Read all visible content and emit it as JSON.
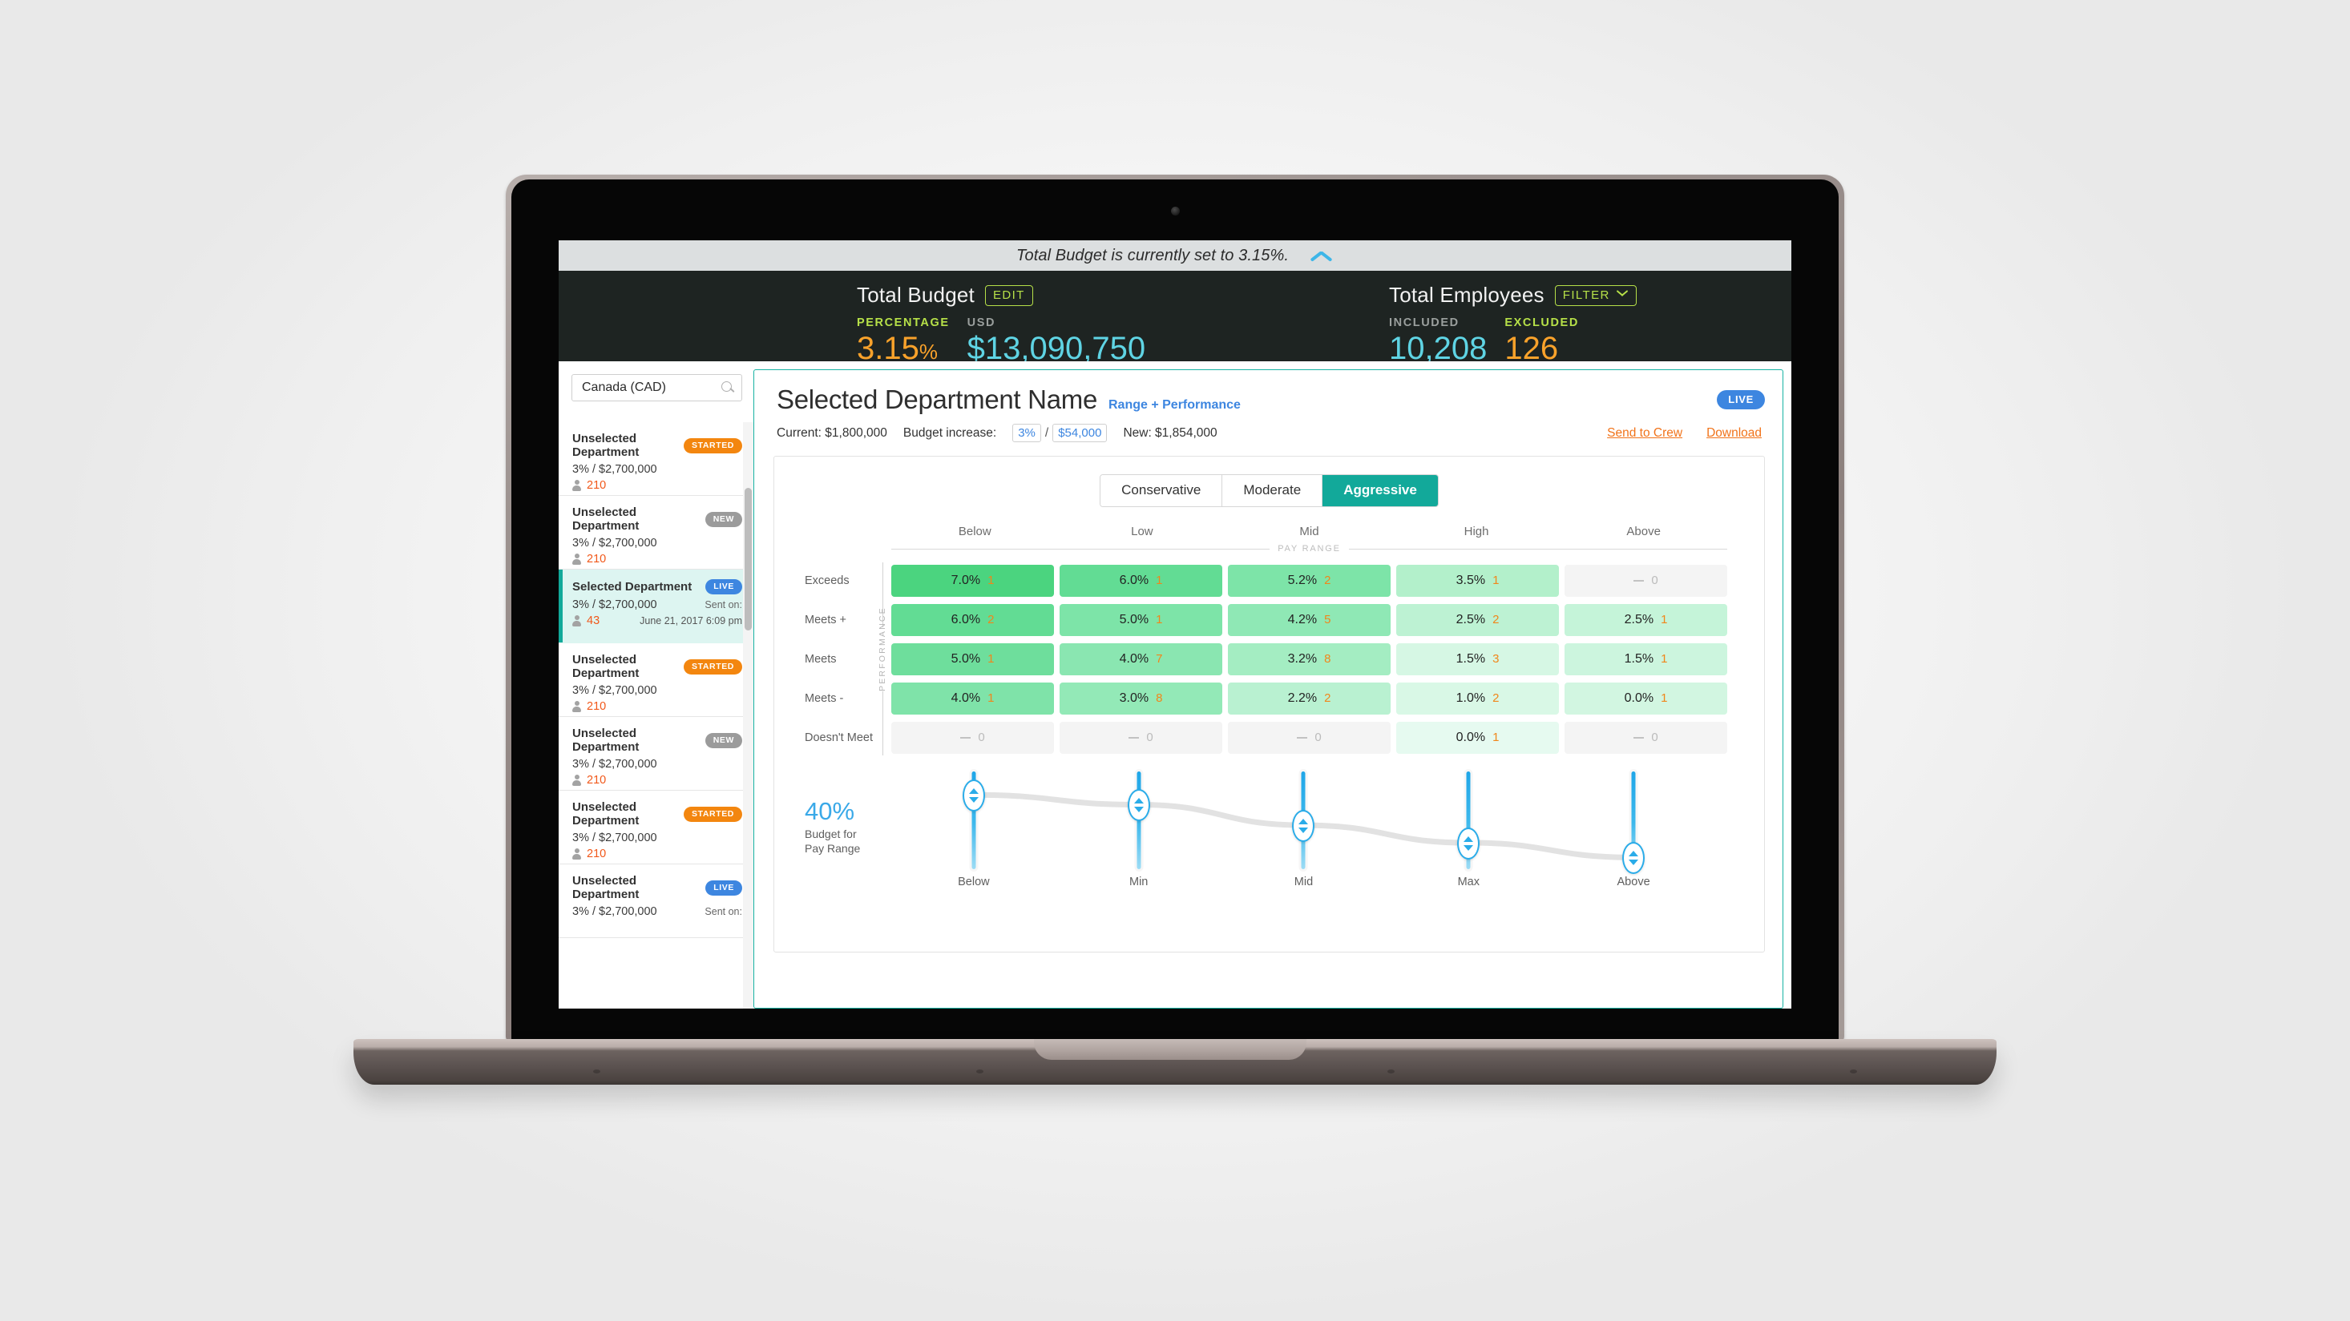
{
  "notice": {
    "text": "Total Budget is currently set to 3.15%.",
    "collapse_icon": "chevron-up-icon"
  },
  "header": {
    "budget": {
      "title": "Total Budget",
      "edit_label": "EDIT",
      "metrics": [
        {
          "label": "PERCENTAGE",
          "value": "3.15",
          "unit": "%"
        },
        {
          "label": "USD",
          "value": "$13,090,750",
          "unit": ""
        }
      ]
    },
    "employees": {
      "title": "Total Employees",
      "filter_label": "FILTER",
      "metrics": [
        {
          "label": "INCLUDED",
          "value": "10,208"
        },
        {
          "label": "EXCLUDED",
          "value": "126"
        }
      ]
    }
  },
  "sidebar": {
    "search": {
      "value": "Canada (CAD)",
      "placeholder": "Search",
      "icon": "search-icon"
    },
    "departments": [
      {
        "name": "Unselected Department",
        "badge": "STARTED",
        "badge_type": "started",
        "money": "3%  /  $2,700,000",
        "count": "210",
        "sent_label": "",
        "sent_date": "",
        "selected": false
      },
      {
        "name": "Unselected Department",
        "badge": "NEW",
        "badge_type": "new",
        "money": "3%  /  $2,700,000",
        "count": "210",
        "sent_label": "",
        "sent_date": "",
        "selected": false
      },
      {
        "name": "Selected Department",
        "badge": "LIVE",
        "badge_type": "live",
        "money": "3%  /  $2,700,000",
        "count": "43",
        "sent_label": "Sent on:",
        "sent_date": "June 21, 2017 6:09 pm",
        "selected": true
      },
      {
        "name": "Unselected Department",
        "badge": "STARTED",
        "badge_type": "started",
        "money": "3%  /  $2,700,000",
        "count": "210",
        "sent_label": "",
        "sent_date": "",
        "selected": false
      },
      {
        "name": "Unselected Department",
        "badge": "NEW",
        "badge_type": "new",
        "money": "3%  /  $2,700,000",
        "count": "210",
        "sent_label": "",
        "sent_date": "",
        "selected": false
      },
      {
        "name": "Unselected Department",
        "badge": "STARTED",
        "badge_type": "started",
        "money": "3%  /  $2,700,000",
        "count": "210",
        "sent_label": "",
        "sent_date": "",
        "selected": false
      },
      {
        "name": "Unselected Department",
        "badge": "LIVE",
        "badge_type": "live",
        "money": "3%  /  $2,700,000",
        "count": "",
        "sent_label": "Sent on:",
        "sent_date": "",
        "selected": false
      }
    ]
  },
  "main": {
    "title": "Selected Department Name",
    "subtitle": "Range + Performance",
    "live_badge": "LIVE",
    "current_label": "Current: $1,800,000",
    "increase_label": "Budget increase:",
    "increase_pct": "3%",
    "increase_amount": "$54,000",
    "new_label": "New: $1,854,000",
    "send_link": "Send to Crew",
    "download_link": "Download",
    "tabs": [
      {
        "label": "Conservative",
        "active": false
      },
      {
        "label": "Moderate",
        "active": false
      },
      {
        "label": "Aggressive",
        "active": true
      }
    ],
    "pay_range_axis": "PAY RANGE",
    "performance_axis": "PERFORMANCE",
    "budget_for_pay_range": {
      "percent": "40%",
      "line1": "Budget for",
      "line2": "Pay Range"
    }
  },
  "chart_data": {
    "type": "heatmap",
    "title": "Range + Performance matrix",
    "xlabel": "PAY RANGE",
    "ylabel": "PERFORMANCE",
    "categories": [
      "Below",
      "Low",
      "Mid",
      "High",
      "Above"
    ],
    "rows": [
      "Exceeds",
      "Meets +",
      "Meets",
      "Meets -",
      "Doesn't Meet"
    ],
    "cells": [
      [
        {
          "pct": "7.0%",
          "count": "1",
          "shade": "#4bd47f"
        },
        {
          "pct": "6.0%",
          "count": "1",
          "shade": "#62dc94"
        },
        {
          "pct": "5.2%",
          "count": "2",
          "shade": "#7de4a8"
        },
        {
          "pct": "3.5%",
          "count": "1",
          "shade": "#b3f0cb"
        },
        {
          "pct": "—",
          "count": "0",
          "shade": "#f4f4f4"
        }
      ],
      [
        {
          "pct": "6.0%",
          "count": "2",
          "shade": "#62dc94"
        },
        {
          "pct": "5.0%",
          "count": "1",
          "shade": "#7de4a8"
        },
        {
          "pct": "4.2%",
          "count": "5",
          "shade": "#8fe8b5"
        },
        {
          "pct": "2.5%",
          "count": "2",
          "shade": "#bdf2d3"
        },
        {
          "pct": "2.5%",
          "count": "1",
          "shade": "#c5f4d9"
        }
      ],
      [
        {
          "pct": "5.0%",
          "count": "1",
          "shade": "#6ede9c"
        },
        {
          "pct": "4.0%",
          "count": "7",
          "shade": "#8ae6b1"
        },
        {
          "pct": "3.2%",
          "count": "8",
          "shade": "#a4edc2"
        },
        {
          "pct": "1.5%",
          "count": "3",
          "shade": "#d6f7e4"
        },
        {
          "pct": "1.5%",
          "count": "1",
          "shade": "#ccf5de"
        }
      ],
      [
        {
          "pct": "4.0%",
          "count": "1",
          "shade": "#7fe3a9"
        },
        {
          "pct": "3.0%",
          "count": "8",
          "shade": "#93e9b7"
        },
        {
          "pct": "2.2%",
          "count": "2",
          "shade": "#b9f1d1"
        },
        {
          "pct": "1.0%",
          "count": "2",
          "shade": "#d9f8e6"
        },
        {
          "pct": "0.0%",
          "count": "1",
          "shade": "#d2f6e1"
        }
      ],
      [
        {
          "pct": "—",
          "count": "0",
          "shade": "#f4f4f4"
        },
        {
          "pct": "—",
          "count": "0",
          "shade": "#f4f4f4"
        },
        {
          "pct": "—",
          "count": "0",
          "shade": "#f4f4f4"
        },
        {
          "pct": "0.0%",
          "count": "1",
          "shade": "#e6faf0"
        },
        {
          "pct": "—",
          "count": "0",
          "shade": "#f4f4f4"
        }
      ]
    ],
    "sliders": {
      "labels": [
        "Below",
        "Min",
        "Mid",
        "Max",
        "Above"
      ],
      "handle_positions_pct": [
        24,
        34,
        55,
        73,
        88
      ],
      "budget_for_pay_range_pct": 40
    }
  },
  "colors": {
    "accent_teal": "#12a99a",
    "accent_blue": "#3d86e0",
    "accent_orange": "#f1731a",
    "accent_green": "#b6e048",
    "metric_cyan": "#5fd4e4",
    "metric_orange": "#f9a22b",
    "dark_header": "#1e2422"
  }
}
